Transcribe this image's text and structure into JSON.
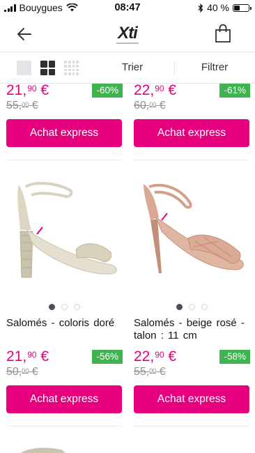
{
  "status": {
    "carrier": "Bouygues",
    "time": "08:47",
    "battery": "40 %",
    "battery_level": 0.4
  },
  "nav": {
    "logo": "Xti",
    "back_icon": "arrow-left-icon",
    "bag_icon": "shopping-bag-icon"
  },
  "toolbar": {
    "sort_label": "Trier",
    "filter_label": "Filtrer"
  },
  "colors": {
    "accent": "#e6007e",
    "discount": "#3fb34f",
    "old_price": "#8f8f8f"
  },
  "products_top": [
    {
      "price_int": "21,",
      "price_dec": "90",
      "currency": "€",
      "old_int": "55,",
      "old_dec": "00",
      "old_currency": "€",
      "discount": "-60%",
      "button": "Achat express"
    },
    {
      "price_int": "22,",
      "price_dec": "90",
      "currency": "€",
      "old_int": "60,",
      "old_dec": "00",
      "old_currency": "€",
      "discount": "-61%",
      "button": "Achat express"
    }
  ],
  "products": [
    {
      "name": "Salomés  -  coloris doré",
      "price_int": "21,",
      "price_dec": "90",
      "currency": "€",
      "old_int": "50,",
      "old_dec": "00",
      "old_currency": "€",
      "discount": "-56%",
      "button": "Achat express"
    },
    {
      "name": "Salomés  -  beige rosé  -  talon : 11 cm",
      "price_int": "22,",
      "price_dec": "90",
      "currency": "€",
      "old_int": "55,",
      "old_dec": "00",
      "old_currency": "€",
      "discount": "-58%",
      "button": "Achat express"
    }
  ]
}
